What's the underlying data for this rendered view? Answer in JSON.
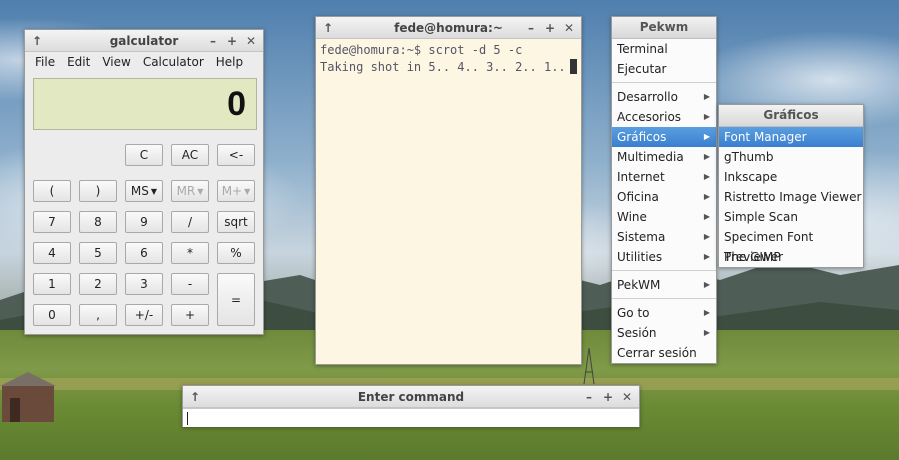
{
  "galculator": {
    "title": "galculator",
    "menu": [
      "File",
      "Edit",
      "View",
      "Calculator",
      "Help"
    ],
    "display_value": "0",
    "buttons": {
      "c": "C",
      "ac": "AC",
      "backspace": "<-",
      "paren_open": "(",
      "paren_close": ")",
      "ms": "MS",
      "mr": "MR",
      "mplus": "M+",
      "n7": "7",
      "n8": "8",
      "n9": "9",
      "div": "/",
      "sqrt": "sqrt",
      "n4": "4",
      "n5": "5",
      "n6": "6",
      "mul": "*",
      "pct": "%",
      "n1": "1",
      "n2": "2",
      "n3": "3",
      "sub": "-",
      "eq": "=",
      "n0": "0",
      "dot": ",",
      "sign": "+/-",
      "add": "+"
    }
  },
  "terminal": {
    "title": "fede@homura:~",
    "lines": [
      "fede@homura:~$ scrot -d 5 -c",
      "Taking shot in 5.. 4.. 3.. 2.. 1.."
    ]
  },
  "pekwm_menu": {
    "title": "Pekwm",
    "items": {
      "terminal": "Terminal",
      "ejecutar": "Ejecutar",
      "desarrollo": "Desarrollo",
      "accesorios": "Accesorios",
      "graficos": "Gráficos",
      "multimedia": "Multimedia",
      "internet": "Internet",
      "oficina": "Oficina",
      "wine": "Wine",
      "sistema": "Sistema",
      "utilities": "Utilities",
      "pekwm": "PekWM",
      "goto": "Go to",
      "sesion": "Sesión",
      "cerrar": "Cerrar sesión"
    }
  },
  "graficos_menu": {
    "title": "Gráficos",
    "items": [
      "Font Manager",
      "gThumb",
      "Inkscape",
      "Ristretto Image Viewer",
      "Simple Scan",
      "Specimen Font Previewer",
      "The GIMP"
    ],
    "selected": "Font Manager"
  },
  "run_dialog": {
    "title": "Enter command",
    "value": ""
  },
  "colors": {
    "menu_highlight": "#3a7fcf",
    "terminal_bg": "#fdf6e3",
    "calc_display_bg": "#e2e8c2"
  }
}
